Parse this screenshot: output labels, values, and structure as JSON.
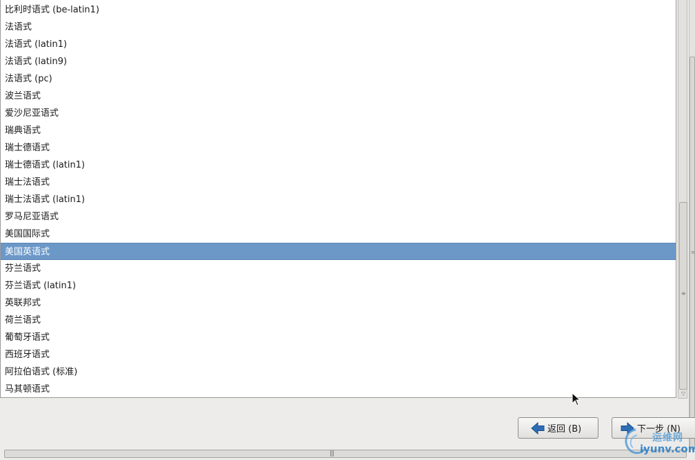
{
  "keyboard_list": {
    "items": [
      "比利时语式 (be-latin1)",
      "法语式",
      "法语式 (latin1)",
      "法语式 (latin9)",
      "法语式 (pc)",
      "波兰语式",
      "爱沙尼亚语式",
      "瑞典语式",
      "瑞士德语式",
      "瑞士德语式 (latin1)",
      "瑞士法语式",
      "瑞士法语式 (latin1)",
      "罗马尼亚语式",
      "美国国际式",
      "美国英语式",
      "芬兰语式",
      "芬兰语式 (latin1)",
      "英联邦式",
      "荷兰语式",
      "葡萄牙语式",
      "西班牙语式",
      "阿拉伯语式 (标准)",
      "马其顿语式"
    ],
    "selected": "美国英语式"
  },
  "buttons": {
    "back_label": "返回 (B)",
    "next_label": "下一步 (N)"
  },
  "watermark": {
    "cn": "运维网",
    "en": "iyunv.com"
  },
  "colors": {
    "selection": "#6c98c8",
    "arrow_icon": "#2e6db5"
  },
  "icons": {
    "back": "arrow-left-icon",
    "next": "arrow-right-icon"
  }
}
